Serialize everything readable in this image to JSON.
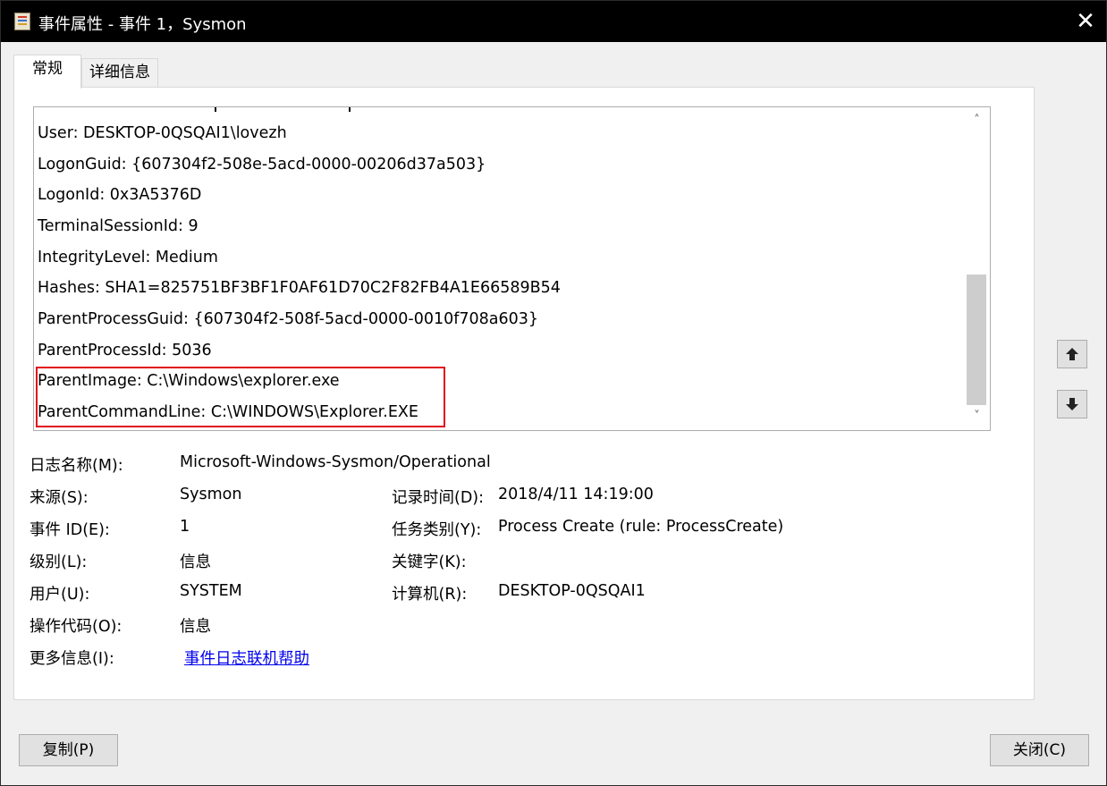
{
  "window": {
    "title": "事件属性 - 事件 1，Sysmon",
    "close_symbol": "✕"
  },
  "tabs": [
    {
      "label": "常规",
      "selected": true
    },
    {
      "label": "详细信息",
      "selected": false
    }
  ],
  "event_xml_lines": [
    "User: DESKTOP-0QSQAI1\\lovezh",
    "LogonGuid: {607304f2-508e-5acd-0000-00206d37a503}",
    "LogonId: 0x3A5376D",
    "TerminalSessionId: 9",
    "IntegrityLevel: Medium",
    "Hashes: SHA1=825751BF3BF1F0AF61D70C2F82FB4A1E66589B54",
    "ParentProcessGuid: {607304f2-508f-5acd-0000-0010f708a603}",
    "ParentProcessId: 5036",
    "ParentImage: C:\\Windows\\explorer.exe",
    "ParentCommandLine: C:\\WINDOWS\\Explorer.EXE"
  ],
  "scrollbar": {
    "up_symbol": "˄",
    "down_symbol": "˅"
  },
  "fields": {
    "log_name_label": "日志名称(M):",
    "log_name_value": "Microsoft-Windows-Sysmon/Operational",
    "source_label": "来源(S):",
    "source_value": "Sysmon",
    "logged_label": "记录时间(D):",
    "logged_value": "2018/4/11 14:19:00",
    "event_id_label": "事件 ID(E):",
    "event_id_value": "1",
    "task_category_label": "任务类别(Y):",
    "task_category_value": "Process Create (rule: ProcessCreate)",
    "level_label": "级别(L):",
    "level_value": "信息",
    "keywords_label": "关键字(K):",
    "keywords_value": "",
    "user_label": "用户(U):",
    "user_value": "SYSTEM",
    "computer_label": "计算机(R):",
    "computer_value": "DESKTOP-0QSQAI1",
    "opcode_label": "操作代码(O):",
    "opcode_value": "信息",
    "more_info_label": "更多信息(I):",
    "more_info_link": "事件日志联机帮助"
  },
  "buttons": {
    "copy": "复制(P)",
    "close": "关闭(C)"
  },
  "colors": {
    "titlebar": "#000000",
    "highlight_box": "#e0101c",
    "link": "#0000ee"
  }
}
